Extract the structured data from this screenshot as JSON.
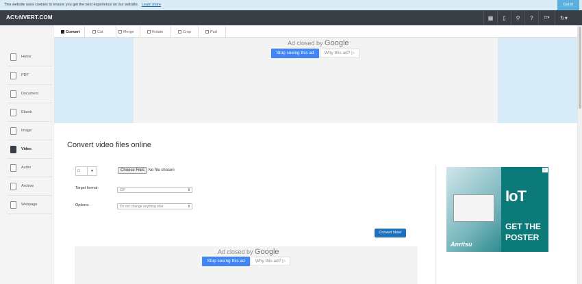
{
  "cookie": {
    "text": "This website uses cookies to ensure you get the best experience on our website.",
    "learn_more": "Learn more",
    "got_it": "Got it!"
  },
  "header": {
    "logo": "AC↻NVERT.COM",
    "buttons": [
      {
        "icon": "grid-icon",
        "glyph": "▦"
      },
      {
        "icon": "bookmark-icon",
        "glyph": "▯"
      },
      {
        "icon": "search-icon",
        "glyph": "⚲"
      },
      {
        "icon": "help-icon",
        "glyph": "?"
      },
      {
        "icon": "language-icon",
        "glyph": "⌗▾"
      },
      {
        "icon": "refresh-icon",
        "glyph": "↻▾"
      }
    ]
  },
  "sidebar": {
    "items": [
      {
        "label": "Home"
      },
      {
        "label": "PDF"
      },
      {
        "label": "Document"
      },
      {
        "label": "Ebook"
      },
      {
        "label": "Image"
      },
      {
        "label": "Video"
      },
      {
        "label": "Audio"
      },
      {
        "label": "Archive"
      },
      {
        "label": "Webpage"
      }
    ],
    "active": "Video"
  },
  "tabs": [
    {
      "label": "Convert"
    },
    {
      "label": "Cut"
    },
    {
      "label": "Merge"
    },
    {
      "label": "Rotate"
    },
    {
      "label": "Crop"
    },
    {
      "label": "Pad"
    }
  ],
  "ad": {
    "closed_by": "Ad closed by",
    "google": "Google",
    "stop": "Stop seeing this ad",
    "why": "Why this ad? ▷"
  },
  "main": {
    "title": "Convert video files online",
    "choose_files": "Choose Files",
    "no_file": "No file chosen",
    "target_format_label": "Target format:",
    "target_format_value": "GIF",
    "options_label": "Options:",
    "options_value": "Do not change anything else",
    "convert_button": "Convert Now!"
  },
  "banner": {
    "headline": "IoT",
    "line1": "GET THE",
    "line2": "POSTER",
    "brand": "Anritsu"
  },
  "colors": {
    "topbar": "#3a3f46",
    "accent": "#1f6fbf",
    "ad_side": "#d7ecf7"
  }
}
